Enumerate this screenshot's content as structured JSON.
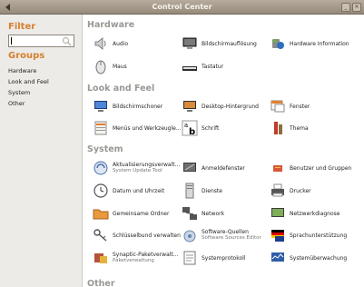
{
  "window": {
    "title": "Control Center",
    "menu_icon": "arrow-icon"
  },
  "sidebar": {
    "filter_label": "Filter",
    "search_value": "",
    "groups_label": "Groups",
    "groups": [
      "Hardware",
      "Look and Feel",
      "System",
      "Other"
    ]
  },
  "sections": {
    "hardware": {
      "title": "Hardware",
      "items": [
        {
          "label": "Audio",
          "icon": "speaker-icon"
        },
        {
          "label": "Bildschirmauflösung",
          "icon": "monitor-icon"
        },
        {
          "label": "Hardware Information",
          "icon": "hardware-info-icon"
        },
        {
          "label": "Maus",
          "icon": "mouse-icon"
        },
        {
          "label": "Tastatur",
          "icon": "keyboard-icon"
        }
      ]
    },
    "look": {
      "title": "Look and Feel",
      "items": [
        {
          "label": "Bildschirmschoner",
          "icon": "screensaver-icon"
        },
        {
          "label": "Desktop-Hintergrund",
          "icon": "wallpaper-icon"
        },
        {
          "label": "Fenster",
          "icon": "window-icon"
        },
        {
          "label": "Menüs und Werkzeugle...",
          "icon": "menu-icon"
        },
        {
          "label": "Schrift",
          "icon": "font-icon"
        },
        {
          "label": "Thema",
          "icon": "theme-icon"
        }
      ]
    },
    "system": {
      "title": "System",
      "items": [
        {
          "label": "Aktualisierungsverwalt...",
          "sub": "System Update Tool",
          "icon": "update-icon"
        },
        {
          "label": "Anmeldefenster",
          "icon": "login-window-icon"
        },
        {
          "label": "Benutzer und Gruppen",
          "icon": "users-icon"
        },
        {
          "label": "Datum und Uhrzeit",
          "icon": "clock-icon"
        },
        {
          "label": "Dienste",
          "icon": "services-icon"
        },
        {
          "label": "Drucker",
          "icon": "printer-icon"
        },
        {
          "label": "Gemeinsame Ordner",
          "icon": "shared-folder-icon"
        },
        {
          "label": "Network",
          "icon": "network-icon"
        },
        {
          "label": "Netzwerkdiagnose",
          "icon": "network-diagnostics-icon"
        },
        {
          "label": "Schlüsselbund verwalten",
          "icon": "keyring-icon"
        },
        {
          "label": "Software-Quellen",
          "sub": "Software Sources Editor",
          "icon": "software-sources-icon"
        },
        {
          "label": "Sprachunterstützung",
          "icon": "language-icon"
        },
        {
          "label": "Synaptic-Paketverwalt...",
          "sub": "Paketverwaltung",
          "icon": "synaptic-icon"
        },
        {
          "label": "Systemprotokoll",
          "icon": "system-log-icon"
        },
        {
          "label": "Systemüberwachung",
          "icon": "system-monitor-icon"
        }
      ]
    },
    "other": {
      "title": "Other"
    }
  }
}
